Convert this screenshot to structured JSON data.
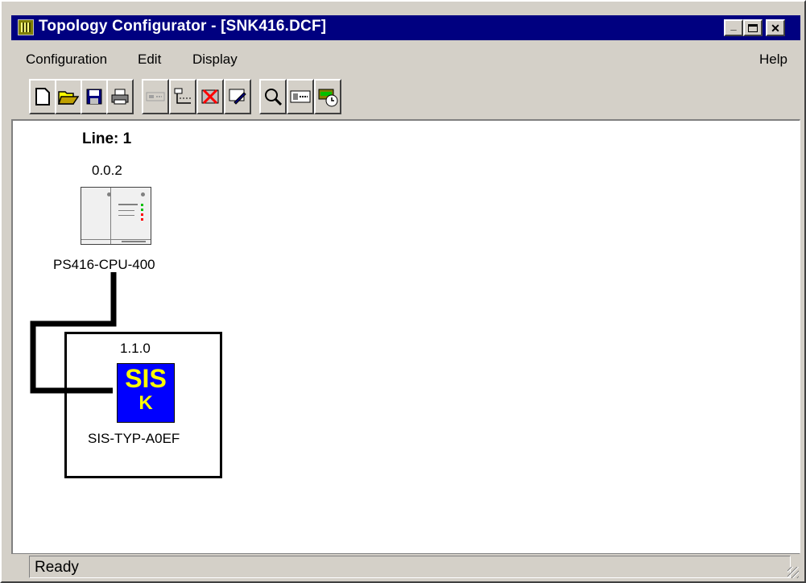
{
  "window": {
    "title": "Topology Configurator - [SNK416.DCF]",
    "controls": {
      "minimize": "_",
      "maximize": "□",
      "close": "✕"
    }
  },
  "menu": {
    "items": [
      "Configuration",
      "Edit",
      "Display"
    ],
    "help": "Help"
  },
  "toolbar": {
    "icons": [
      "new-file-icon",
      "open-folder-icon",
      "save-disk-icon",
      "print-icon",
      "module-disabled-icon",
      "topology-icon",
      "delete-module-icon",
      "tools-icon",
      "zoom-icon",
      "module-view-icon",
      "clock-icon"
    ]
  },
  "canvas": {
    "line_label": "Line: 1",
    "devices": [
      {
        "address": "0.0.2",
        "name": "PS416-CPU-400"
      },
      {
        "address": "1.1.0",
        "name": "SIS-TYP-A0EF",
        "icon_text_top": "SIS",
        "icon_text_bottom": "K"
      }
    ]
  },
  "status": {
    "text": "Ready"
  },
  "colors": {
    "titlebar": "#000080",
    "sis_icon": "#0000ff",
    "sis_text": "#ffff00"
  }
}
